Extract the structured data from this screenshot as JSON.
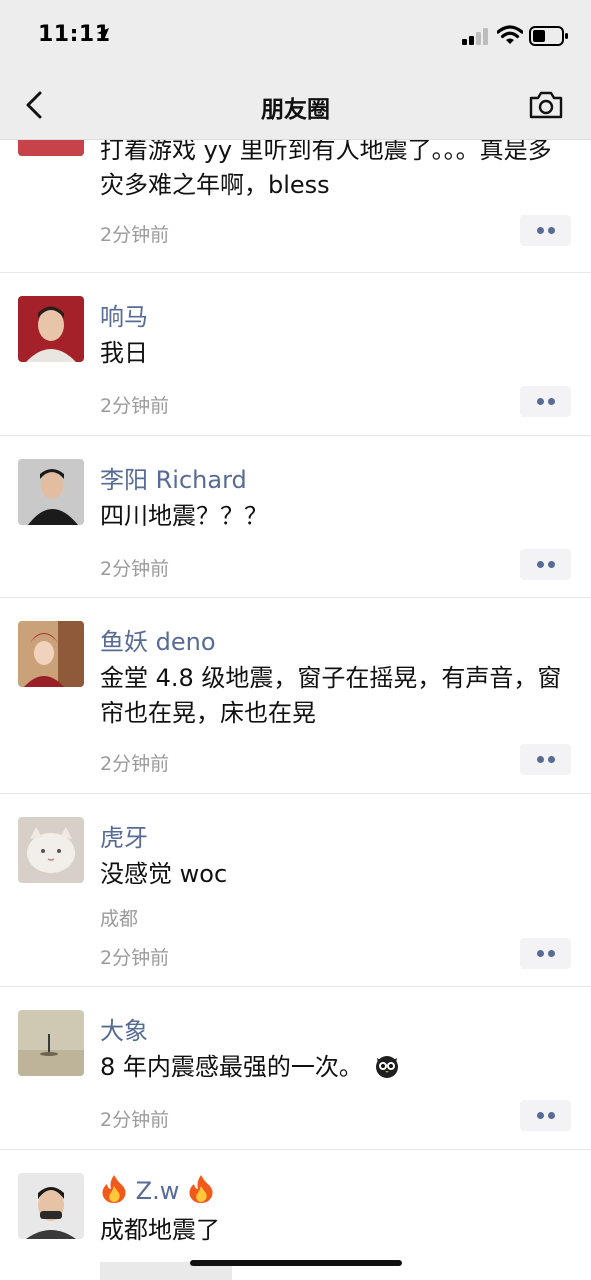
{
  "status_bar": {
    "time": "11:11",
    "icons": [
      "location-arrow-icon",
      "cellular-signal-icon",
      "wifi-icon",
      "battery-icon"
    ]
  },
  "nav": {
    "title": "朋友圈",
    "back_icon": "chevron-left-icon",
    "camera_icon": "camera-icon"
  },
  "posts": [
    {
      "name": "",
      "content": "打着游戏 yy 里听到有人地震了。。。真是多灾多难之年啊，bless",
      "time": "2分钟前"
    },
    {
      "name": "响马",
      "content": "我日",
      "time": "2分钟前"
    },
    {
      "name": "李阳 Richard",
      "content": "四川地震？？？",
      "time": "2分钟前"
    },
    {
      "name": "鱼妖 deno",
      "content": "金堂 4.8 级地震，窗子在摇晃，有声音，窗帘也在晃，床也在晃",
      "time": "2分钟前"
    },
    {
      "name": "虎牙",
      "content": "没感觉 woc",
      "location": "成都",
      "time": "2分钟前"
    },
    {
      "name": "大象",
      "content": "8 年内震感最强的一次。",
      "time": "2分钟前"
    },
    {
      "name": "Z.w",
      "content": "成都地震了"
    }
  ],
  "colors": {
    "link_blue": "#576b95",
    "bar_gray": "#ededed",
    "meta_gray": "#9b9b9b"
  }
}
